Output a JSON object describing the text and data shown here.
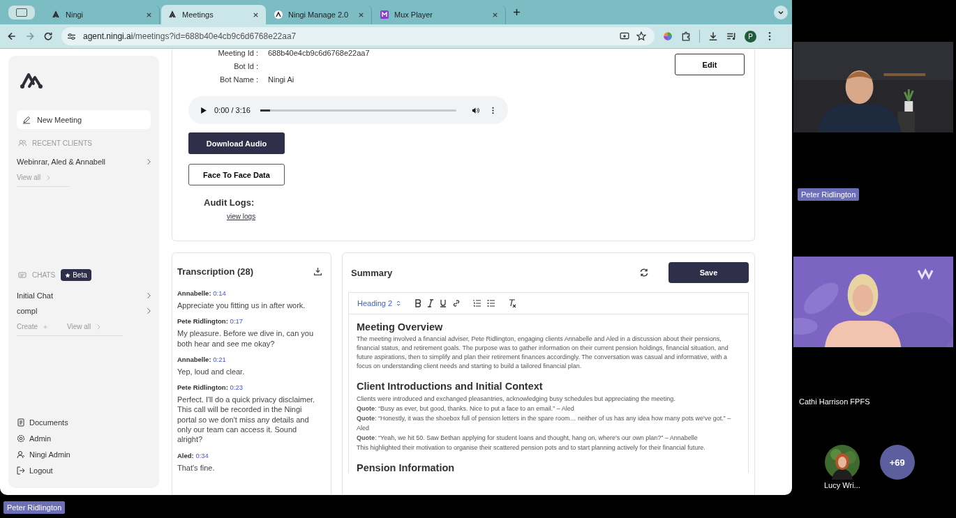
{
  "browser": {
    "tabs": [
      {
        "label": "Ningi",
        "selected": false,
        "kind": "ningi"
      },
      {
        "label": "Meetings",
        "selected": true,
        "kind": "ningi"
      },
      {
        "label": "Ningi Manage 2.0",
        "selected": false,
        "kind": "ningi-round"
      },
      {
        "label": "Mux Player",
        "selected": false,
        "kind": "mux"
      }
    ],
    "url": {
      "host": "agent.ningi.ai",
      "path": "/meetings?id=688b40e4cb9c6d6768e22aa7"
    },
    "profile": "P"
  },
  "sidebar": {
    "new_meeting": "New Meeting",
    "recent_clients": {
      "heading": "RECENT CLIENTS",
      "items": [
        "Webinrar, Aled & Annabell"
      ],
      "view_all": "View all"
    },
    "chats": {
      "heading": "CHATS",
      "badge": "Beta",
      "items": [
        "Initial Chat",
        "compl"
      ],
      "create": "Create",
      "view_all": "View all"
    },
    "footer": [
      {
        "label": "Documents",
        "kind": "doc"
      },
      {
        "label": "Admin",
        "kind": "gear"
      },
      {
        "label": "Ningi Admin",
        "kind": "user"
      },
      {
        "label": "Logout",
        "kind": "logout"
      }
    ]
  },
  "meeting": {
    "fields": [
      {
        "label": "Meeting Id :",
        "value": "688b40e4cb9c6d6768e22aa7"
      },
      {
        "label": "Bot Id :"
      },
      {
        "label": "Bot Name :",
        "value": "Ningi Ai"
      }
    ],
    "edit": "Edit",
    "audio": {
      "time": "0:00 / 3:16",
      "level": 0.05
    },
    "download": "Download Audio",
    "face_to_face": "Face To Face Data",
    "audit_heading": "Audit Logs:",
    "audit_link": "view logs"
  },
  "transcription": {
    "title": "Transcription (28)",
    "entries": [
      {
        "speaker": "Annabelle:",
        "time": "0:14",
        "text": "Appreciate you fitting us in after work."
      },
      {
        "speaker": "Pete Ridlington:",
        "time": "0:17",
        "text": "My pleasure. Before we dive in, can you both hear and see me okay?"
      },
      {
        "speaker": "Annabelle:",
        "time": "0:21",
        "text": "Yep, loud and clear."
      },
      {
        "speaker": "Pete Ridlington:",
        "time": "0:23",
        "text": "Perfect. I'll do a quick privacy disclaimer. This call will be recorded in the Ningi portal so we don't miss any details and only our team can access it. Sound alright?"
      },
      {
        "speaker": "Aled:",
        "time": "0:34",
        "text": "That's fine."
      }
    ]
  },
  "summary": {
    "title": "Summary",
    "save": "Save",
    "format": "Heading 2",
    "blocks": [
      {
        "kind": "heading",
        "text": "Meeting Overview"
      },
      {
        "kind": "paragraph",
        "text": "The meeting involved a financial adviser, Pete Ridlington, engaging clients Annabelle and Aled in a discussion about their pensions, financial status, and retirement goals. The purpose was to gather information on their current pension holdings, financial situation, and future aspirations, then to simplify and plan their retirement finances accordingly. The conversation was casual and informative, with a focus on understanding client needs and starting to build a tailored financial plan."
      },
      {
        "kind": "heading",
        "text": "Client Introductions and Initial Context"
      },
      {
        "kind": "line",
        "text": "Clients were introduced and exchanged pleasantries, acknowledging busy schedules but appreciating the meeting."
      },
      {
        "kind": "line",
        "text": "**Quote**: “Busy as ever, but good, thanks. Nice to put a face to an email.” – Aled"
      },
      {
        "kind": "line",
        "text": "**Quote**: “Honestly, it was the shoebox full of pension letters in the spare room… neither of us has any idea how many pots we've got.” – Aled"
      },
      {
        "kind": "line",
        "text": "**Quote**: “Yeah, we hit 50. Saw Bethan applying for student loans and thought, hang on, where's our own plan?” – Annabelle"
      },
      {
        "kind": "line",
        "text": "This highlighted their motivation to organise their scattered pension pots and to start planning actively for their financial future."
      },
      {
        "kind": "heading",
        "text": "Pension Information"
      }
    ]
  },
  "call": {
    "tiles": [
      {
        "kind": "office",
        "name": "Peter Ridlington",
        "labelled": true
      },
      {
        "kind": "purple",
        "name": "Cathi Harrison FPFS",
        "labelled": false
      }
    ],
    "avatar": {
      "name": "Lucy Wri..."
    },
    "more": "+69",
    "speaker_label": "Peter Ridlington"
  }
}
